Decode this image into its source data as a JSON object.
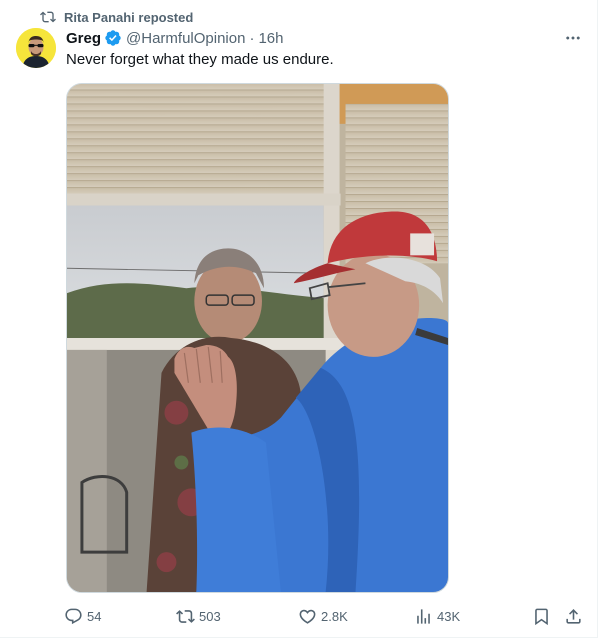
{
  "social_context": {
    "icon": "repost-icon",
    "text": "Rita Panahi reposted"
  },
  "author": {
    "display_name": "Greg",
    "verified": true,
    "verified_color": "#1d9bf0",
    "handle": "@HarmfulOpinion",
    "separator": "·",
    "timestamp": "16h"
  },
  "tweet": {
    "text": "Never forget what they made us endure."
  },
  "actions": {
    "replies": "54",
    "reposts": "503",
    "likes": "2.8K",
    "views": "43K"
  },
  "icons": [
    "repost-icon",
    "more-icon",
    "verified-badge-icon",
    "reply-icon",
    "heart-icon",
    "views-icon",
    "bookmark-icon",
    "share-icon"
  ],
  "colors": {
    "muted": "#536471",
    "text": "#0f1419",
    "accent": "#1d9bf0",
    "avatar_bg": "#f6e53b"
  }
}
